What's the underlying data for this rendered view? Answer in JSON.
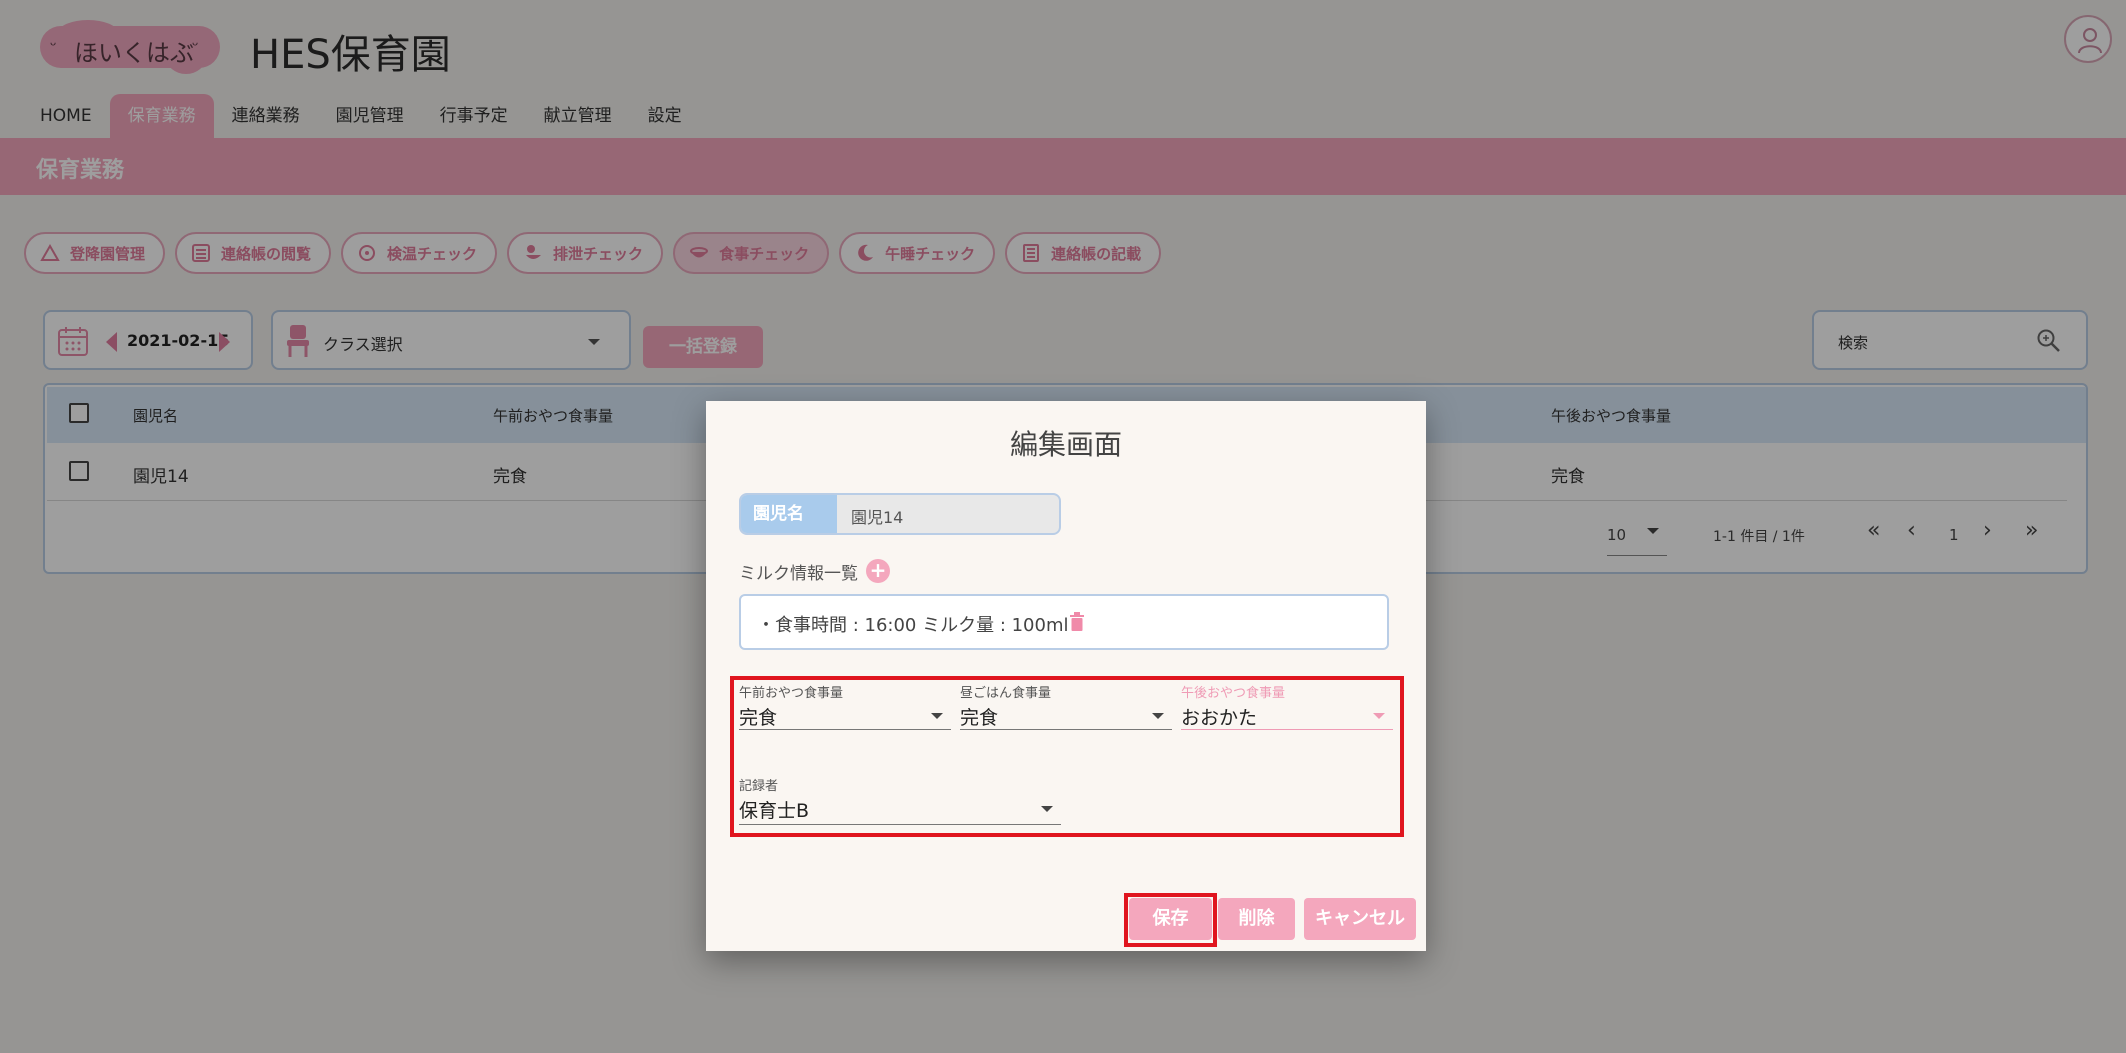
{
  "app": {
    "logo_text": "ほいくはぶ",
    "logo_eye": "ᵕ",
    "title": "HES保育園"
  },
  "nav": {
    "items": [
      "HOME",
      "保育業務",
      "連絡業務",
      "園児管理",
      "行事予定",
      "献立管理",
      "設定"
    ],
    "active_index": 1
  },
  "page": {
    "section_title": "保育業務"
  },
  "subtabs": {
    "items": [
      "登降園管理",
      "連絡帳の閲覧",
      "検温チェック",
      "排泄チェック",
      "食事チェック",
      "午睡チェック",
      "連絡帳の記載"
    ],
    "active_index": 4
  },
  "toolbar": {
    "date": "2021-02-15",
    "class_placeholder": "クラス選択",
    "bulk_register": "一括登録",
    "search_placeholder": "検索"
  },
  "table": {
    "headers": [
      "園児名",
      "午前おやつ食事量",
      "午後おやつ食事量"
    ],
    "rows": [
      {
        "name": "園児14",
        "am_snack": "完食",
        "pm_snack": "完食"
      }
    ],
    "rows_per_page": "10",
    "range_text": "1-1 件目 / 1件",
    "page_first": "«",
    "page_prev": "‹",
    "page_number": "1",
    "page_next": "›",
    "page_last": "»"
  },
  "modal": {
    "title": "編集画面",
    "child_label": "園児名",
    "child_value": "園児14",
    "milk_label": "ミルク情報一覧",
    "milk_add": "+",
    "milk_entry": "・食事時間 : 16:00 ミルク量 : 100ml",
    "fields": {
      "am_snack_label": "午前おやつ食事量",
      "am_snack_value": "完食",
      "lunch_label": "昼ごはん食事量",
      "lunch_value": "完食",
      "pm_snack_label": "午後おやつ食事量",
      "pm_snack_value": "おおかた",
      "recorder_label": "記録者",
      "recorder_value": "保育士B"
    },
    "buttons": {
      "save": "保存",
      "delete": "削除",
      "cancel": "キャンセル"
    }
  },
  "colors": {
    "accent_pink": "#f4a7bd",
    "accent_blue": "#b9cde6",
    "highlight_red": "#e0151f"
  }
}
